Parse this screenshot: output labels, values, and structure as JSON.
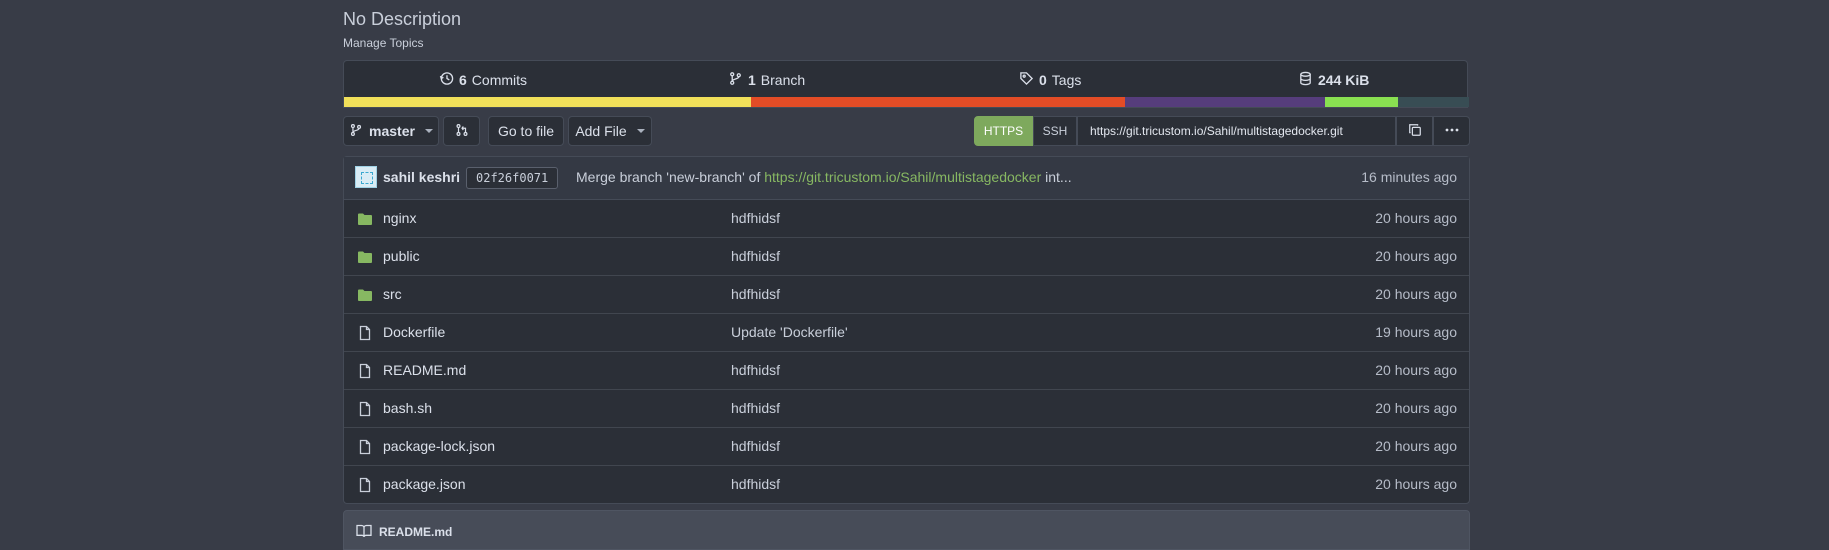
{
  "repo": {
    "description": "No Description",
    "manage_topics": "Manage Topics"
  },
  "stats": {
    "commits_count": "6",
    "commits_label": "Commits",
    "branches_count": "1",
    "branches_label": "Branch",
    "tags_count": "0",
    "tags_label": "Tags",
    "size": "244 KiB"
  },
  "language_bar": [
    {
      "color": "#f1e05a",
      "percent": 36.2
    },
    {
      "color": "#e34c26",
      "percent": 33.2
    },
    {
      "color": "#563d7c",
      "percent": 17.8
    },
    {
      "color": "#89e051",
      "percent": 6.5
    },
    {
      "color": "#384d54",
      "percent": 6.3
    }
  ],
  "toolbar": {
    "branch": "master",
    "go_to_file": "Go to file",
    "add_file": "Add File",
    "https": "HTTPS",
    "ssh": "SSH",
    "clone_url": "https://git.tricustom.io/Sahil/multistagedocker.git"
  },
  "latest_commit": {
    "author": "sahil keshri",
    "sha": "02f26f0071",
    "message_prefix": "Merge branch 'new-branch' of",
    "message_link": "https://git.tricustom.io/Sahil/multistagedocker",
    "message_suffix": "int...",
    "time": "16 minutes ago"
  },
  "files": [
    {
      "type": "folder",
      "name": "nginx",
      "message": "hdfhidsf",
      "time": "20 hours ago"
    },
    {
      "type": "folder",
      "name": "public",
      "message": "hdfhidsf",
      "time": "20 hours ago"
    },
    {
      "type": "folder",
      "name": "src",
      "message": "hdfhidsf",
      "time": "20 hours ago"
    },
    {
      "type": "file",
      "name": "Dockerfile",
      "message": "Update 'Dockerfile'",
      "time": "19 hours ago"
    },
    {
      "type": "file",
      "name": "README.md",
      "message": "hdfhidsf",
      "time": "20 hours ago"
    },
    {
      "type": "file",
      "name": "bash.sh",
      "message": "hdfhidsf",
      "time": "20 hours ago"
    },
    {
      "type": "file",
      "name": "package-lock.json",
      "message": "hdfhidsf",
      "time": "20 hours ago"
    },
    {
      "type": "file",
      "name": "package.json",
      "message": "hdfhidsf",
      "time": "20 hours ago"
    }
  ],
  "readme": {
    "title": "README.md"
  },
  "colors": {
    "accent_green": "#7ea95d",
    "folder_green": "#87b862",
    "background": "#383c47"
  }
}
